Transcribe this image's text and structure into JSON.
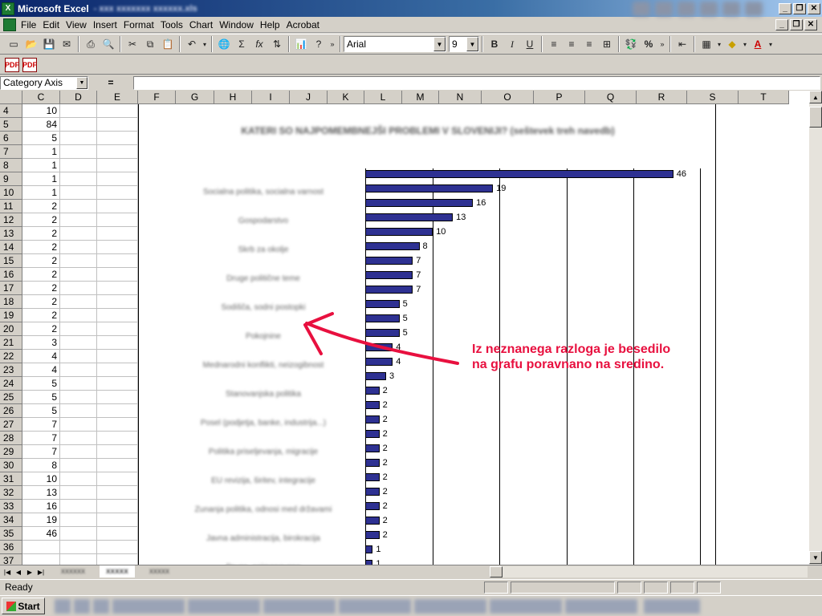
{
  "window": {
    "app_title": "Microsoft Excel",
    "file_title": "- xxx xxxxxxx xxxxxx.xls"
  },
  "menu": [
    "File",
    "Edit",
    "View",
    "Insert",
    "Format",
    "Tools",
    "Chart",
    "Window",
    "Help",
    "Acrobat"
  ],
  "toolbar": {
    "font_name": "Arial",
    "font_size": "9",
    "bold": "B",
    "italic": "I",
    "underline": "U",
    "percent": "%"
  },
  "formula_bar": {
    "name_box": "Category Axis",
    "equals": "="
  },
  "columns": [
    "C",
    "D",
    "E",
    "F",
    "G",
    "H",
    "I",
    "J",
    "K",
    "L",
    "M",
    "N",
    "O",
    "P",
    "Q",
    "R",
    "S",
    "T"
  ],
  "rows": [
    {
      "num": "4",
      "c": "10"
    },
    {
      "num": "5",
      "c": "84"
    },
    {
      "num": "6",
      "c": "5"
    },
    {
      "num": "7",
      "c": "1"
    },
    {
      "num": "8",
      "c": "1"
    },
    {
      "num": "9",
      "c": "1"
    },
    {
      "num": "10",
      "c": "1"
    },
    {
      "num": "11",
      "c": "2"
    },
    {
      "num": "12",
      "c": "2"
    },
    {
      "num": "13",
      "c": "2"
    },
    {
      "num": "14",
      "c": "2"
    },
    {
      "num": "15",
      "c": "2"
    },
    {
      "num": "16",
      "c": "2"
    },
    {
      "num": "17",
      "c": "2"
    },
    {
      "num": "18",
      "c": "2"
    },
    {
      "num": "19",
      "c": "2"
    },
    {
      "num": "20",
      "c": "2"
    },
    {
      "num": "21",
      "c": "3"
    },
    {
      "num": "22",
      "c": "4"
    },
    {
      "num": "23",
      "c": "4"
    },
    {
      "num": "24",
      "c": "5"
    },
    {
      "num": "25",
      "c": "5"
    },
    {
      "num": "26",
      "c": "5"
    },
    {
      "num": "27",
      "c": "7"
    },
    {
      "num": "28",
      "c": "7"
    },
    {
      "num": "29",
      "c": "7"
    },
    {
      "num": "30",
      "c": "8"
    },
    {
      "num": "31",
      "c": "10"
    },
    {
      "num": "32",
      "c": "13"
    },
    {
      "num": "33",
      "c": "16"
    },
    {
      "num": "34",
      "c": "19"
    },
    {
      "num": "35",
      "c": "46"
    },
    {
      "num": "36",
      "c": ""
    },
    {
      "num": "37",
      "c": ""
    }
  ],
  "chart_data": {
    "type": "bar",
    "orientation": "horizontal",
    "title": "KATERI SO NAJPOMEMBNEJŠI PROBLEMI V SLOVENIJI? (seštevek treh navedb)",
    "values": [
      46,
      19,
      16,
      13,
      10,
      8,
      7,
      7,
      7,
      5,
      5,
      5,
      4,
      4,
      3,
      2,
      2,
      2,
      2,
      2,
      2,
      2,
      2,
      2,
      2,
      2,
      1,
      1,
      1
    ],
    "visible_category_labels": [
      "Socialna politika, socialna varnost",
      "Gospodarstvo",
      "Skrb za okolje",
      "Druge politične teme",
      "Sodišča, sodni postopki",
      "Pokojnine",
      "Mednarodni konflikti, neizogibnost",
      "Stanovanjska politika",
      "Posel (podjetja, banke, industrija...)",
      "Politika priseljevanja, migracije",
      "EU revizija, širitev, integracije",
      "Zunanja politika, odnosi med državami",
      "Javna administracija, birokracija",
      "Drugo, neimenovano"
    ],
    "xlim": [
      0,
      50
    ],
    "grid": true,
    "bar_color": "#2e3192"
  },
  "annotation": {
    "line1": "Iz neznanega razloga je besedilo",
    "line2": "na grafu poravnano na sredino.",
    "color": "#e8103f"
  },
  "sheet_tabs": [
    "xxxxxx",
    "xxxxx",
    "xxxxx"
  ],
  "status": "Ready",
  "taskbar": {
    "start": "Start"
  }
}
